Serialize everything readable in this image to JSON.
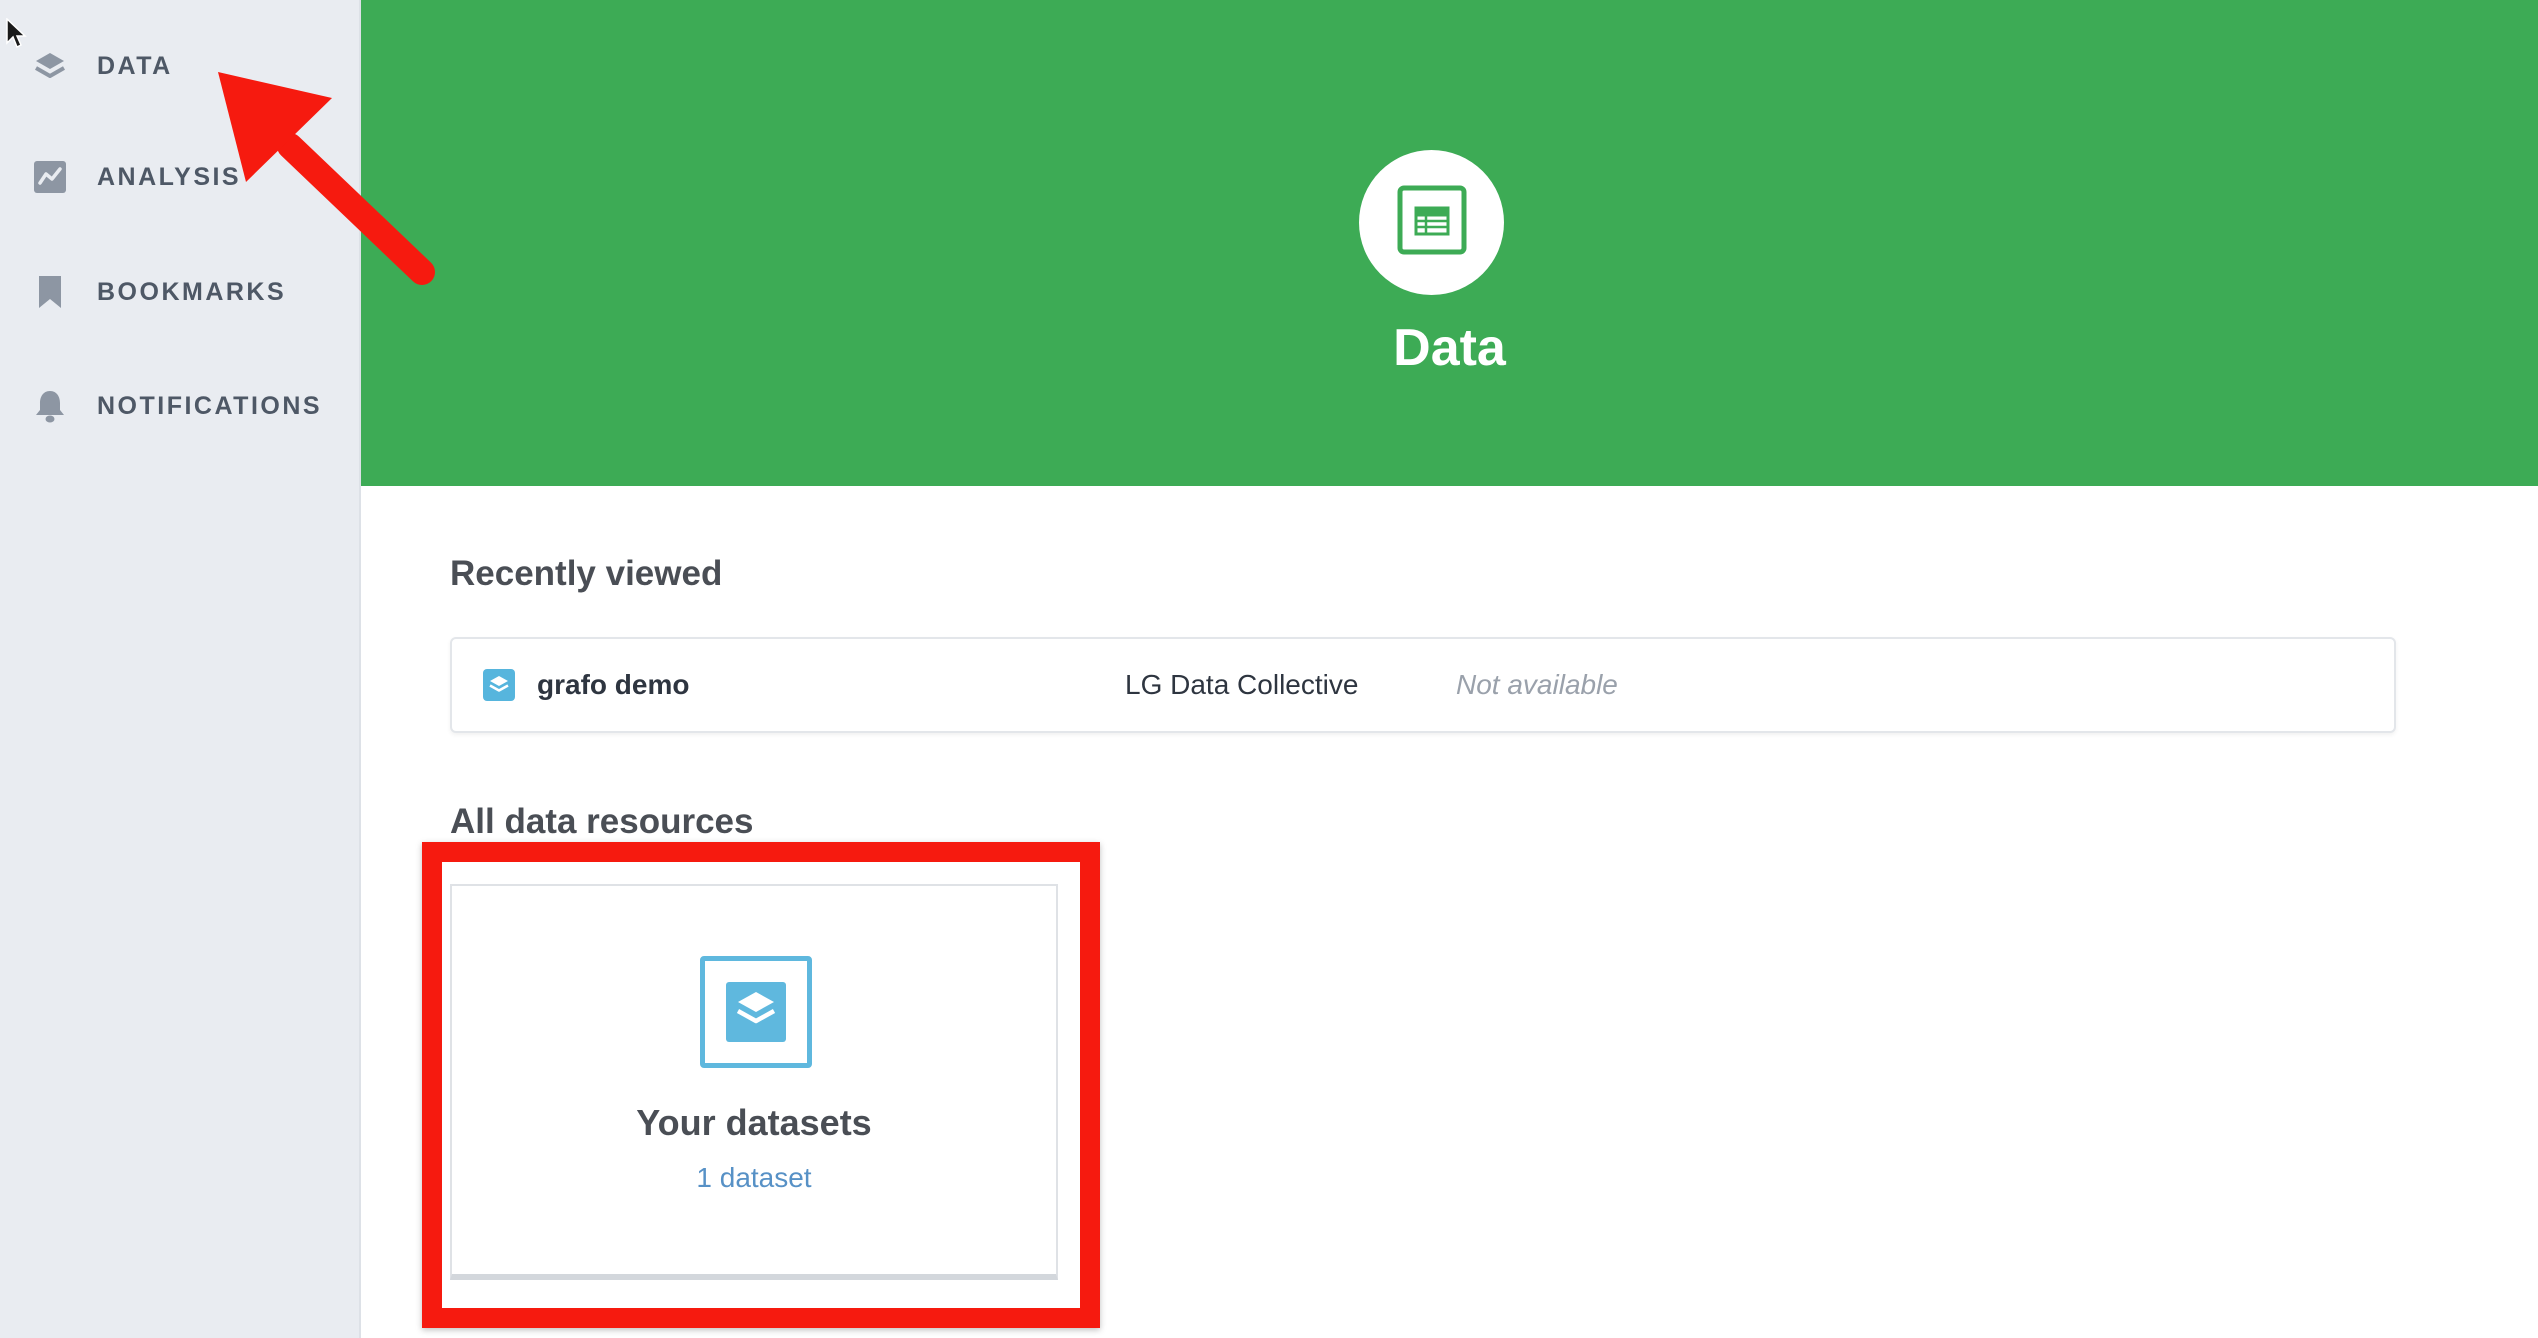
{
  "sidebar": {
    "items": [
      {
        "label": "DATA",
        "icon": "layers-icon"
      },
      {
        "label": "ANALYSIS",
        "icon": "chart-line-icon"
      },
      {
        "label": "BOOKMARKS",
        "icon": "bookmark-icon"
      },
      {
        "label": "NOTIFICATIONS",
        "icon": "bell-icon"
      }
    ]
  },
  "header": {
    "title": "Data",
    "icon": "table-icon",
    "background_color": "#3dab55"
  },
  "recently_viewed": {
    "title": "Recently viewed",
    "items": [
      {
        "name": "grafo demo",
        "collection": "LG Data Collective",
        "status": "Not available",
        "icon": "dataset-icon"
      }
    ]
  },
  "all_resources": {
    "title": "All data resources",
    "cards": [
      {
        "title": "Your datasets",
        "count": "1 dataset",
        "icon": "dataset-layers-icon"
      }
    ]
  },
  "annotation": {
    "highlight_color": "#f61a0f",
    "arrow_color": "#f61a0f"
  }
}
